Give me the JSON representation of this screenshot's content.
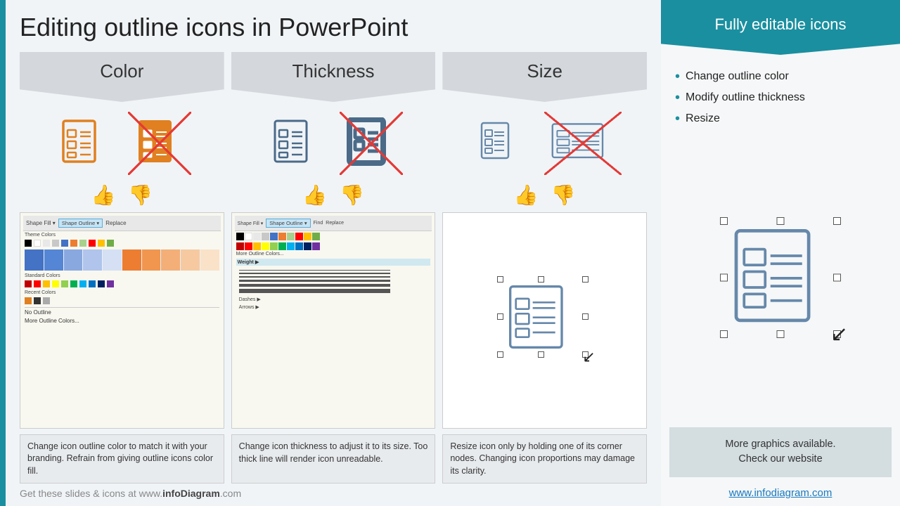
{
  "page": {
    "title": "Editing outline icons in PowerPoint",
    "footer": "Get these slides & icons at www.",
    "footer_brand": "infoDiagram",
    "footer_domain": ".com"
  },
  "columns": [
    {
      "id": "color",
      "header": "Color",
      "description": "Change icon outline color to match it with your branding. Refrain from giving outline icons color fill."
    },
    {
      "id": "thickness",
      "header": "Thickness",
      "description": "Change icon thickness to adjust it to its size. Too thick line will render icon unreadable."
    },
    {
      "id": "size",
      "header": "Size",
      "description": "Resize icon only by holding one of its corner nodes. Changing icon proportions may damage its clarity."
    }
  ],
  "sidebar": {
    "header": "Fully editable icons",
    "bullets": [
      "Change outline color",
      "Modify outline thickness",
      "Resize"
    ],
    "bottom_text": "More graphics available.\nCheck our website",
    "link_text": "www.infodiagram.com",
    "link_url": "http://www.infodiagram.com"
  },
  "colors": {
    "teal": "#1a8fa0",
    "blue": "#1a7abf",
    "orange": "#e08020",
    "red_cross": "#e53935",
    "thumb_up": "#1a7abf",
    "thumb_down": "#e05050"
  },
  "color_swatches": {
    "theme": [
      "#000",
      "#fff",
      "#e8e8e8",
      "#c8c8c8",
      "#4472c4",
      "#ed7d31",
      "#a9d18e",
      "#ff0000",
      "#ffc000",
      "#70ad47"
    ],
    "standard": [
      "#c00000",
      "#ff0000",
      "#ffc000",
      "#ffff00",
      "#92d050",
      "#00b050",
      "#00b0f0",
      "#0070c0",
      "#002060",
      "#7030a0"
    ],
    "recent": [
      "#e08020",
      "#333333",
      "#aaaaaa"
    ]
  }
}
